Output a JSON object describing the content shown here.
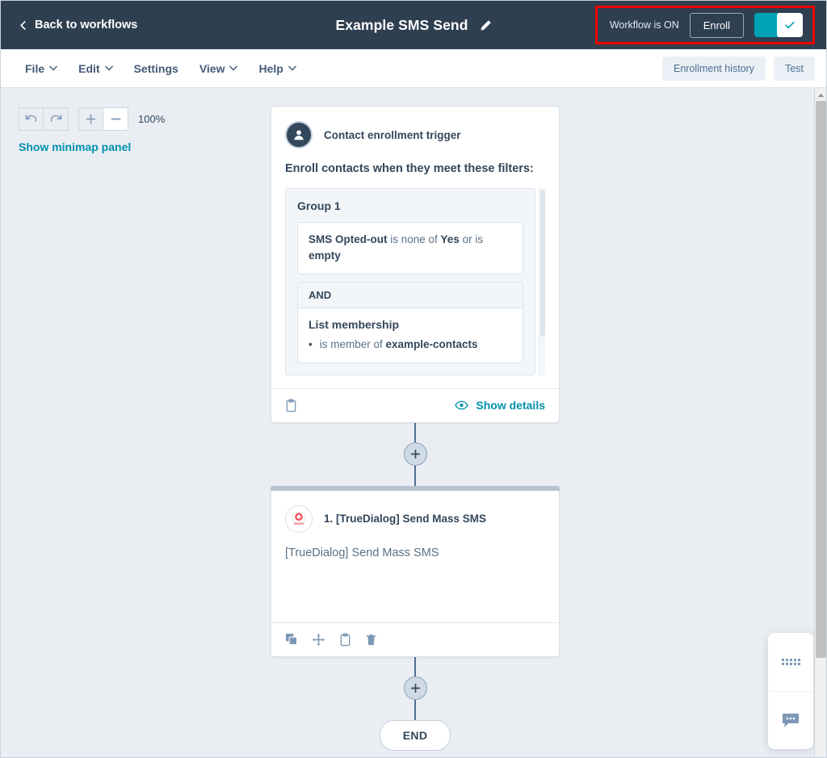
{
  "header": {
    "back_label": "Back to workflows",
    "workflow_title": "Example SMS Send",
    "edit_icon": "pencil-icon",
    "status_label": "Workflow is ON",
    "enroll_label": "Enroll",
    "toggle_state": "on",
    "toggle_icon": "check-icon",
    "highlight_color": "#ee0000",
    "toggle_color": "#00a2b5",
    "bg_color": "#2e3f50"
  },
  "toolbar": {
    "menu": [
      {
        "label": "File",
        "has_chevron": true
      },
      {
        "label": "Edit",
        "has_chevron": true
      },
      {
        "label": "Settings",
        "has_chevron": false
      },
      {
        "label": "View",
        "has_chevron": true
      },
      {
        "label": "Help",
        "has_chevron": true
      }
    ],
    "enrollment_history_label": "Enrollment history",
    "test_label": "Test"
  },
  "canvas_controls": {
    "undo_icon": "undo-icon",
    "redo_icon": "redo-icon",
    "zoom_in_icon": "plus-icon",
    "zoom_out_icon": "minus-icon",
    "zoom_level": "100%",
    "minimap_label": "Show minimap panel",
    "link_color": "#0091ae"
  },
  "trigger_card": {
    "icon": "contact-avatar-icon",
    "title": "Contact enrollment trigger",
    "subtitle": "Enroll contacts when they meet these filters:",
    "group": {
      "title": "Group 1",
      "filter": {
        "prefix_bold": "SMS Opted-out",
        "mid": " is none of ",
        "value_bold": "Yes",
        "suffix": " or is ",
        "suffix_bold": "empty"
      },
      "operator": "AND",
      "list_filter": {
        "title": "List membership",
        "bullet_prefix": "is member of ",
        "bullet_bold": "example-contacts"
      }
    },
    "footer": {
      "copy_icon": "clipboard-icon",
      "show_details_label": "Show details",
      "show_details_icon": "eye-icon"
    }
  },
  "action_card": {
    "icon": "truedialog-logo-icon",
    "title": "1. [TrueDialog] Send Mass SMS",
    "body_text": "[TrueDialog] Send Mass SMS",
    "footer_icons": [
      "duplicate-icon",
      "move-icon",
      "clipboard-icon",
      "delete-icon"
    ]
  },
  "flow": {
    "add_step_icon": "plus-icon",
    "end_label": "END"
  },
  "chat_widget": {
    "drag_handle_icon": "dot-grid-icon",
    "chat_icon": "chat-bubble-icon"
  }
}
